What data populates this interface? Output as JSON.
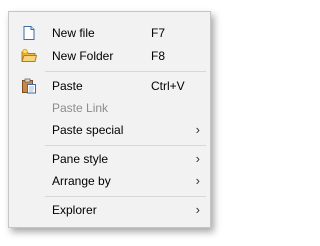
{
  "menu": {
    "items": [
      {
        "label": "New file",
        "shortcut": "F7",
        "icon": "new-file-icon"
      },
      {
        "label": "New Folder",
        "shortcut": "F8",
        "icon": "new-folder-icon"
      },
      {
        "label": "Paste",
        "shortcut": "Ctrl+V",
        "icon": "paste-icon"
      },
      {
        "label": "Paste Link",
        "disabled": true
      },
      {
        "label": "Paste special",
        "submenu": true
      },
      {
        "label": "Pane style",
        "submenu": true
      },
      {
        "label": "Arrange by",
        "submenu": true
      },
      {
        "label": "Explorer",
        "submenu": true
      }
    ],
    "submenu_arrow": "›",
    "colors": {
      "background": "#f2f2f2",
      "border": "#c6c6c6",
      "disabled_text": "#8c8c8c",
      "separator": "#d7d7d7"
    }
  }
}
